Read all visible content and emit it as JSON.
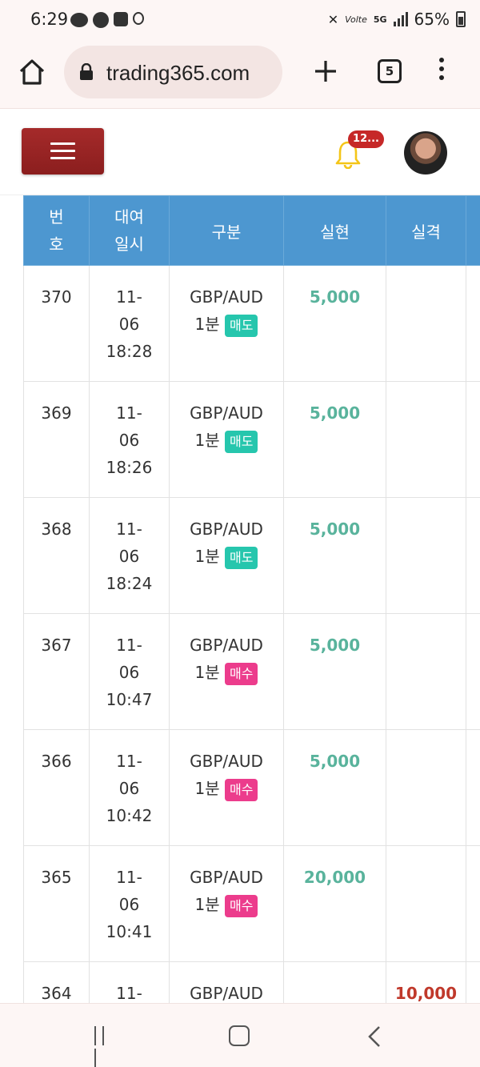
{
  "status_bar": {
    "time": "6:29",
    "network_label": "5G",
    "volte_label": "Volte",
    "battery": "65%"
  },
  "browser": {
    "url": "trading365.com",
    "tab_count": "5"
  },
  "header": {
    "notification_count": "12..."
  },
  "table": {
    "headers": {
      "no": [
        "번",
        "호"
      ],
      "date": [
        "대여",
        "일시"
      ],
      "type": "구분",
      "realized": "실현",
      "lost": "실격"
    },
    "rows": [
      {
        "no": "370",
        "date": [
          "11-",
          "06",
          "18:28"
        ],
        "pair": "GBP/AUD",
        "period": "1분",
        "side": "매도",
        "side_kind": "sell",
        "realized": "5,000",
        "lost": ""
      },
      {
        "no": "369",
        "date": [
          "11-",
          "06",
          "18:26"
        ],
        "pair": "GBP/AUD",
        "period": "1분",
        "side": "매도",
        "side_kind": "sell",
        "realized": "5,000",
        "lost": ""
      },
      {
        "no": "368",
        "date": [
          "11-",
          "06",
          "18:24"
        ],
        "pair": "GBP/AUD",
        "period": "1분",
        "side": "매도",
        "side_kind": "sell",
        "realized": "5,000",
        "lost": ""
      },
      {
        "no": "367",
        "date": [
          "11-",
          "06",
          "10:47"
        ],
        "pair": "GBP/AUD",
        "period": "1분",
        "side": "매수",
        "side_kind": "buy",
        "realized": "5,000",
        "lost": ""
      },
      {
        "no": "366",
        "date": [
          "11-",
          "06",
          "10:42"
        ],
        "pair": "GBP/AUD",
        "period": "1분",
        "side": "매수",
        "side_kind": "buy",
        "realized": "5,000",
        "lost": ""
      },
      {
        "no": "365",
        "date": [
          "11-",
          "06",
          "10:41"
        ],
        "pair": "GBP/AUD",
        "period": "1분",
        "side": "매수",
        "side_kind": "buy",
        "realized": "20,000",
        "lost": ""
      },
      {
        "no": "364",
        "date": [
          "11-",
          "",
          ""
        ],
        "pair": "GBP/AUD",
        "period": "",
        "side": "",
        "side_kind": "",
        "realized": "",
        "lost": "10,000"
      }
    ]
  },
  "colors": {
    "header_bg": "#4d97d0",
    "realized": "#59b39c",
    "lost": "#c0392b",
    "sell_tag": "#26c6ad",
    "buy_tag": "#ec3c8c",
    "menu_button": "#a52a2a"
  },
  "icons": {
    "home": "home-icon",
    "lock": "lock-icon",
    "new_tab": "plus-icon",
    "more": "more-vertical-icon",
    "menu": "hamburger-icon",
    "bell": "bell-icon",
    "nav_recent": "recent-apps-icon",
    "nav_home": "home-square-icon",
    "nav_back": "back-chevron-icon"
  }
}
